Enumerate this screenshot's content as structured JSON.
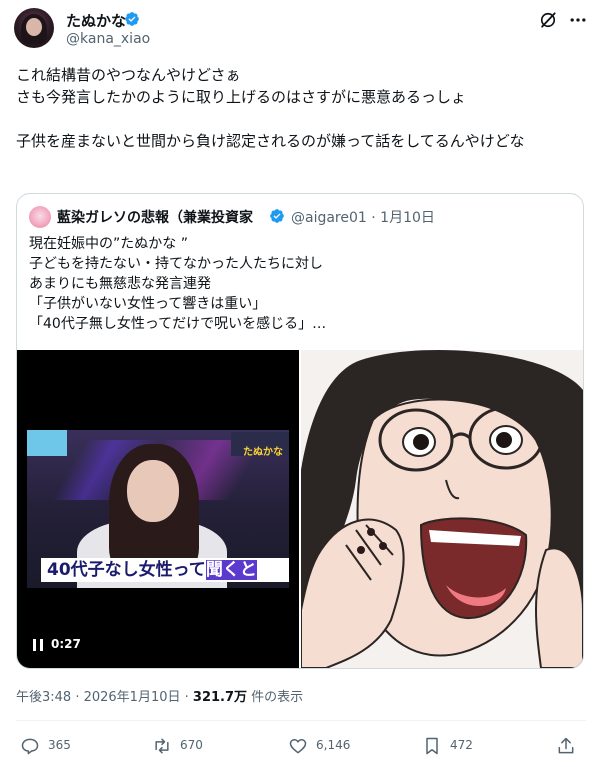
{
  "author": {
    "display_name": "たぬかな",
    "handle": "@kana_xiao",
    "verified_color": "#1d9bf0"
  },
  "tweet": {
    "text": "これ結構昔のやつなんやけどさぁ\nさも今発言したかのように取り上げるのはさすがに悪意あるっしょ\n\n子供を産まないと世間から負け認定されるのが嫌って話をしてるんやけどな"
  },
  "quoted": {
    "display_name": "藍染ガレソの悲報（兼業投資家",
    "handle": "@aigare01",
    "separator": "·",
    "date": "1月10日",
    "text": "現在妊娠中の”たぬかな ”\n子どもを持たない・持てなかった人たちに対し\nあまりにも無慈悲な発言連発\n「子供がいない女性って響きは重い」\n「40代子無し女性ってだけで呪いを感じる」…",
    "video": {
      "caption_part1": "40代子なし女性って",
      "caption_part2": "聞くと",
      "badge": "たぬかな",
      "time": "0:27"
    }
  },
  "meta": {
    "time": "午後3:48 · 2026年1月10日 ·",
    "views": "321.7万",
    "views_suffix": "件の表示"
  },
  "actions": {
    "replies": "365",
    "reposts": "670",
    "likes": "6,146",
    "bookmarks": "472"
  },
  "icons": [
    "grok-icon",
    "more-icon",
    "verified-icon",
    "pause-icon",
    "reply-icon",
    "repost-icon",
    "like-icon",
    "bookmark-icon",
    "share-icon"
  ]
}
